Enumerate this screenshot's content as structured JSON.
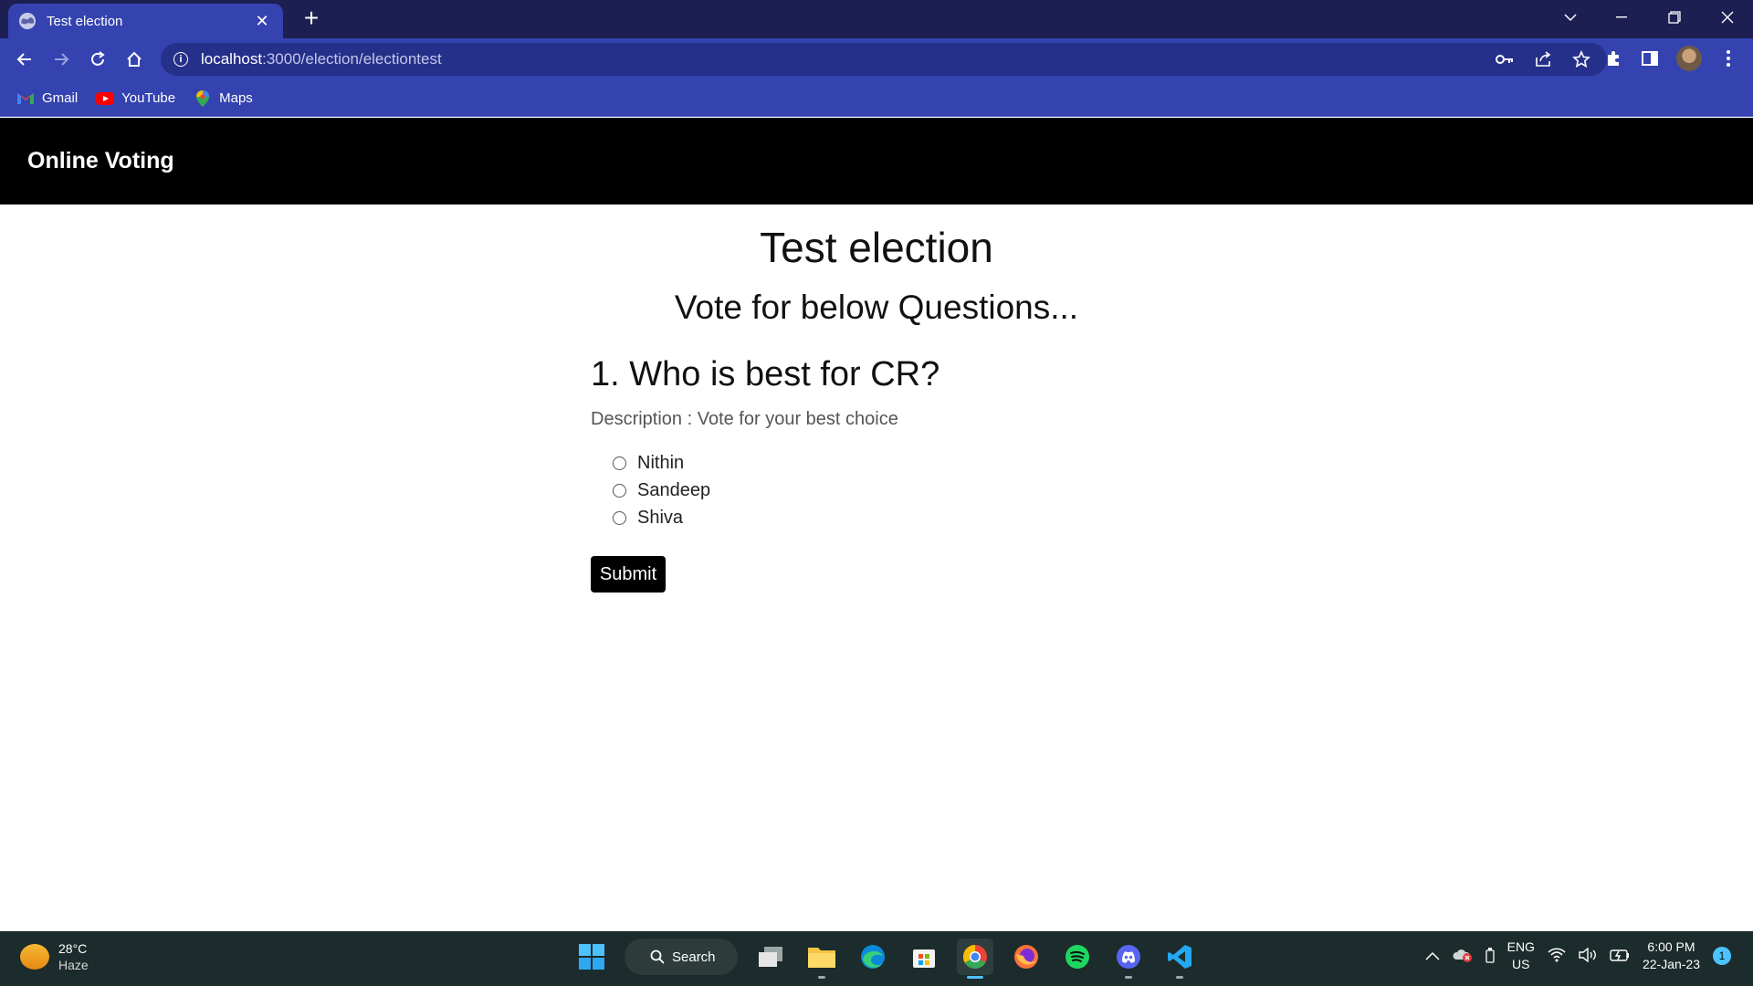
{
  "browser": {
    "tab_title": "Test election",
    "url_host": "localhost",
    "url_path": ":3000/election/electiontest",
    "bookmarks": [
      {
        "label": "Gmail",
        "icon": "gmail-icon"
      },
      {
        "label": "YouTube",
        "icon": "youtube-icon"
      },
      {
        "label": "Maps",
        "icon": "maps-icon"
      }
    ],
    "accent_color": "#3443b0",
    "tabstrip_color": "#1d1f52"
  },
  "page": {
    "brand": "Online Voting",
    "election_title": "Test election",
    "subtitle": "Vote for below Questions...",
    "question": {
      "title": "1. Who is best for CR?",
      "description": "Description : Vote for your best choice",
      "options": [
        "Nithin",
        "Sandeep",
        "Shiva"
      ]
    },
    "submit_label": "Submit"
  },
  "taskbar": {
    "weather_temp": "28°C",
    "weather_desc": "Haze",
    "search_label": "Search",
    "lang_1": "ENG",
    "lang_2": "US",
    "time": "6:00 PM",
    "date": "22-Jan-23",
    "notification_count": "1"
  }
}
